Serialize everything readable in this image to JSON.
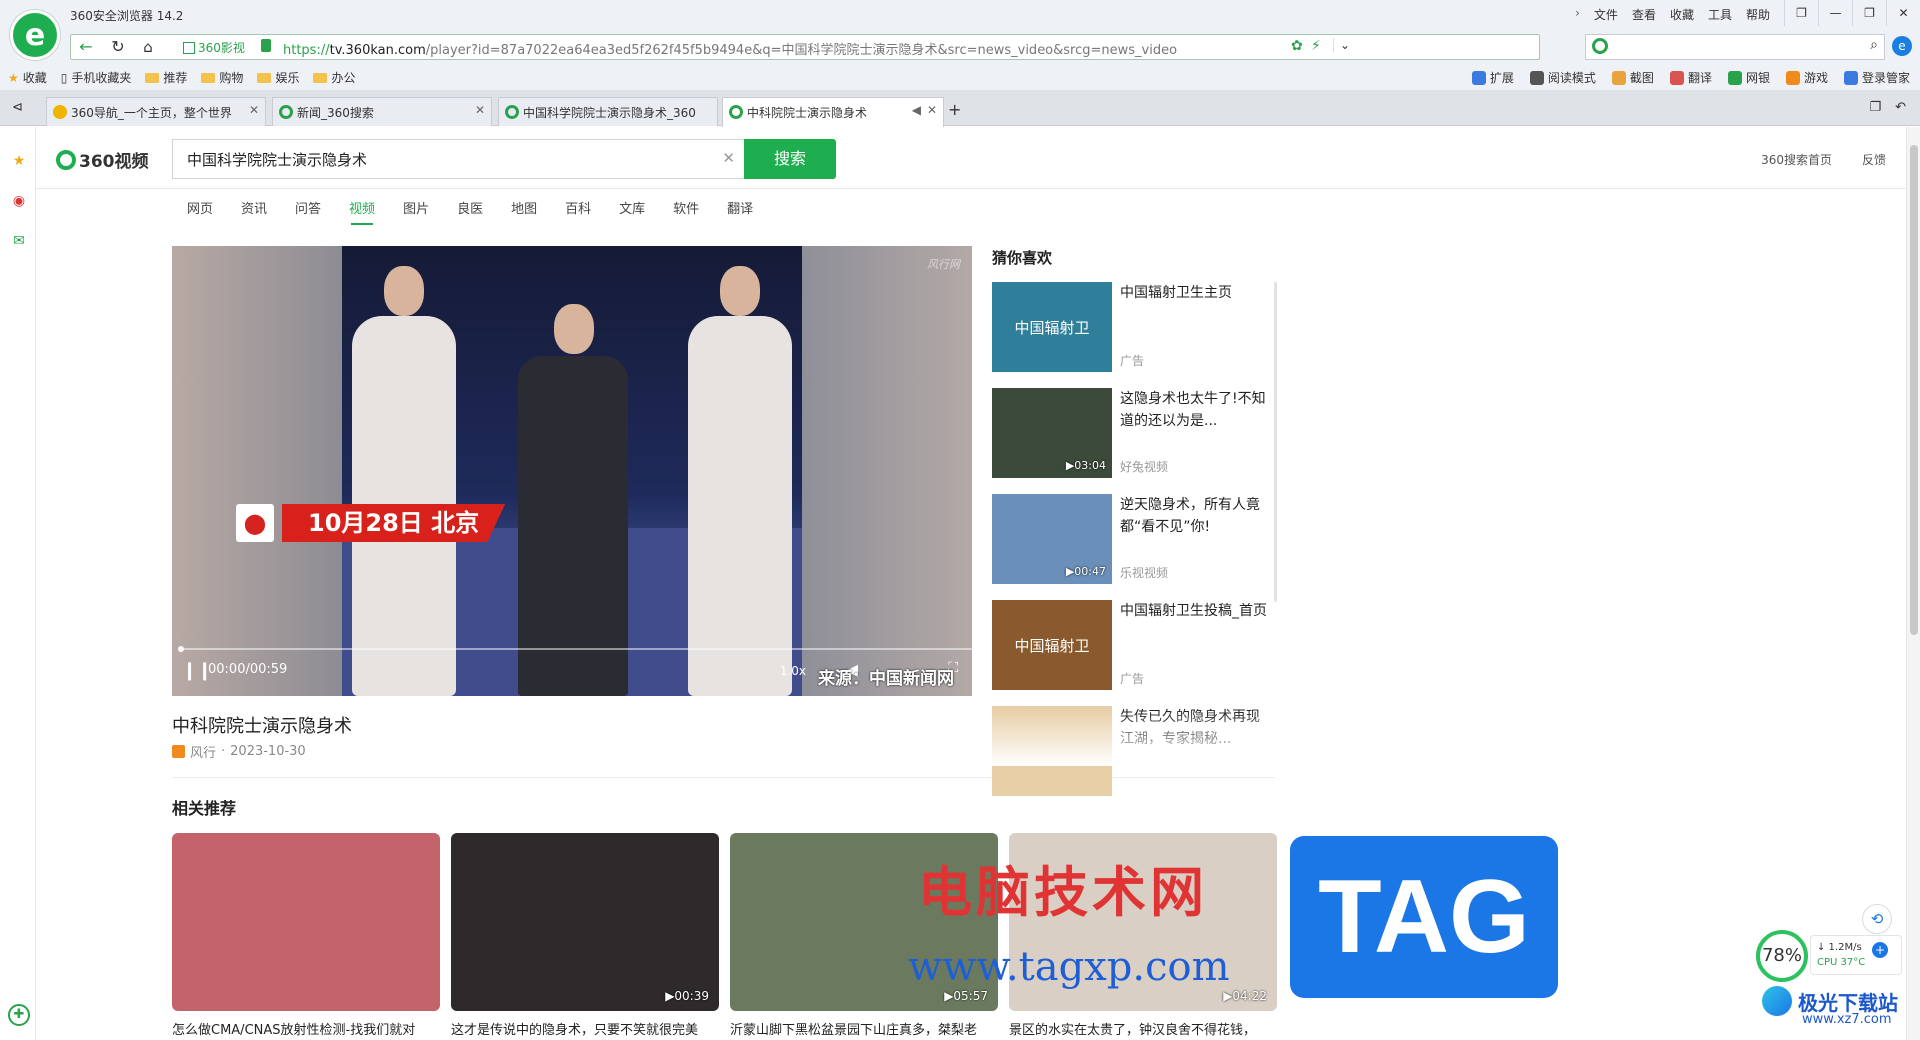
{
  "browser": {
    "title": "360安全浏览器 14.2",
    "menu": [
      "文件",
      "查看",
      "收藏",
      "工具",
      "帮助"
    ],
    "window_controls": [
      "❐",
      "—",
      "❐",
      "✕"
    ],
    "site_badge": "360影视",
    "url_scheme": "https://",
    "url_host": "tv.360kan.com",
    "url_rest": "/player?id=87a7022ea64ea3ed5f262f45f5b9494e&q=中国科学院院士演示隐身术&src=news_video&srcg=news_video",
    "search_placeholder": "",
    "bookmarks_left": [
      {
        "label": "收藏",
        "icon": "star-icon"
      },
      {
        "label": "手机收藏夹",
        "icon": "phone-icon"
      },
      {
        "label": "推荐",
        "icon": "folder-icon"
      },
      {
        "label": "购物",
        "icon": "folder-icon"
      },
      {
        "label": "娱乐",
        "icon": "folder-icon"
      },
      {
        "label": "办公",
        "icon": "folder-icon"
      }
    ],
    "bookmarks_right": [
      {
        "label": "扩展",
        "color": "#3b7be0"
      },
      {
        "label": "阅读模式",
        "color": "#555555"
      },
      {
        "label": "截图",
        "color": "#e8a33d"
      },
      {
        "label": "翻译",
        "color": "#d9534f"
      },
      {
        "label": "网银",
        "color": "#2aa24b"
      },
      {
        "label": "游戏",
        "color": "#f08a1c"
      },
      {
        "label": "登录管家",
        "color": "#3b7be0"
      }
    ],
    "tabs": [
      {
        "label": "360导航_一个主页，整个世界",
        "active": false,
        "favicon": "#f0b400"
      },
      {
        "label": "新闻_360搜索",
        "active": false,
        "favicon": "#2aa24b"
      },
      {
        "label": "中国科学院院士演示隐身术_360",
        "active": false,
        "favicon": "#2aa24b"
      },
      {
        "label": "中科院院士演示隐身术",
        "active": true,
        "favicon": "#2aa24b"
      }
    ]
  },
  "page": {
    "logo_text": "360视频",
    "query": "中国科学院院士演示隐身术",
    "search_button": "搜索",
    "header_links": [
      "360搜索首页",
      "反馈"
    ],
    "categories": [
      "网页",
      "资讯",
      "问答",
      "视频",
      "图片",
      "良医",
      "地图",
      "百科",
      "文库",
      "软件",
      "翻译"
    ],
    "active_category": "视频"
  },
  "player": {
    "date_tag": "10月28日 北京",
    "time": "00:00/00:59",
    "speed": "1.0x",
    "source_text": "来源：中国新闻网",
    "corner_logo": "风行网",
    "progress": 0
  },
  "video": {
    "title": "中科院院士演示隐身术",
    "source": "风行",
    "date": "2023-10-30"
  },
  "guess": {
    "title": "猜你喜欢",
    "items": [
      {
        "text": "中国辐射卫生主页",
        "source": "广告",
        "thumb_text": "中国辐射卫",
        "duration": "",
        "color": "#2f7f9a"
      },
      {
        "text": "这隐身术也太牛了!不知道的还以为是...",
        "source": "好兔视频",
        "thumb_text": "",
        "duration": "▶03:04",
        "color": "#3b4a3a"
      },
      {
        "text": "逆天隐身术，所有人竟都“看不见”你!",
        "source": "乐视视频",
        "thumb_text": "",
        "duration": "▶00:47",
        "color": "#6a8fb8"
      },
      {
        "text": "中国辐射卫生投稿_首页",
        "source": "广告",
        "thumb_text": "中国辐射卫",
        "duration": "",
        "color": "#8a5a2e"
      },
      {
        "text": "失传已久的隐身术再现江湖，专家揭秘...",
        "source": "",
        "thumb_text": "",
        "duration": "",
        "color": "#e8cfa8"
      }
    ]
  },
  "related": {
    "title": "相关推荐",
    "items": [
      {
        "text": "怎么做CMA/CNAS放射性检测-找我们就对",
        "duration": "",
        "color": "#c4636a"
      },
      {
        "text": "这才是传说中的隐身术，只要不笑就很完美",
        "duration": "▶00:39",
        "color": "#2e2a2c"
      },
      {
        "text": "沂蒙山脚下黑松盆景园下山庄真多，桀梨老",
        "duration": "▶05:57",
        "color": "#6b7a5e"
      },
      {
        "text": "景区的水实在太贵了，钟汉良舍不得花钱，",
        "duration": "▶04:22",
        "color": "#d9cfc4"
      }
    ]
  },
  "overlay": {
    "watermark": "电脑技术网",
    "watermark_url": "www.tagxp.com",
    "tag": "TAG",
    "perf_percent": "78%",
    "net_speed": "↓ 1.2M/s",
    "cpu": "CPU 37°C",
    "site_logo": "极光下载站",
    "site_url": "www.xz7.com"
  }
}
